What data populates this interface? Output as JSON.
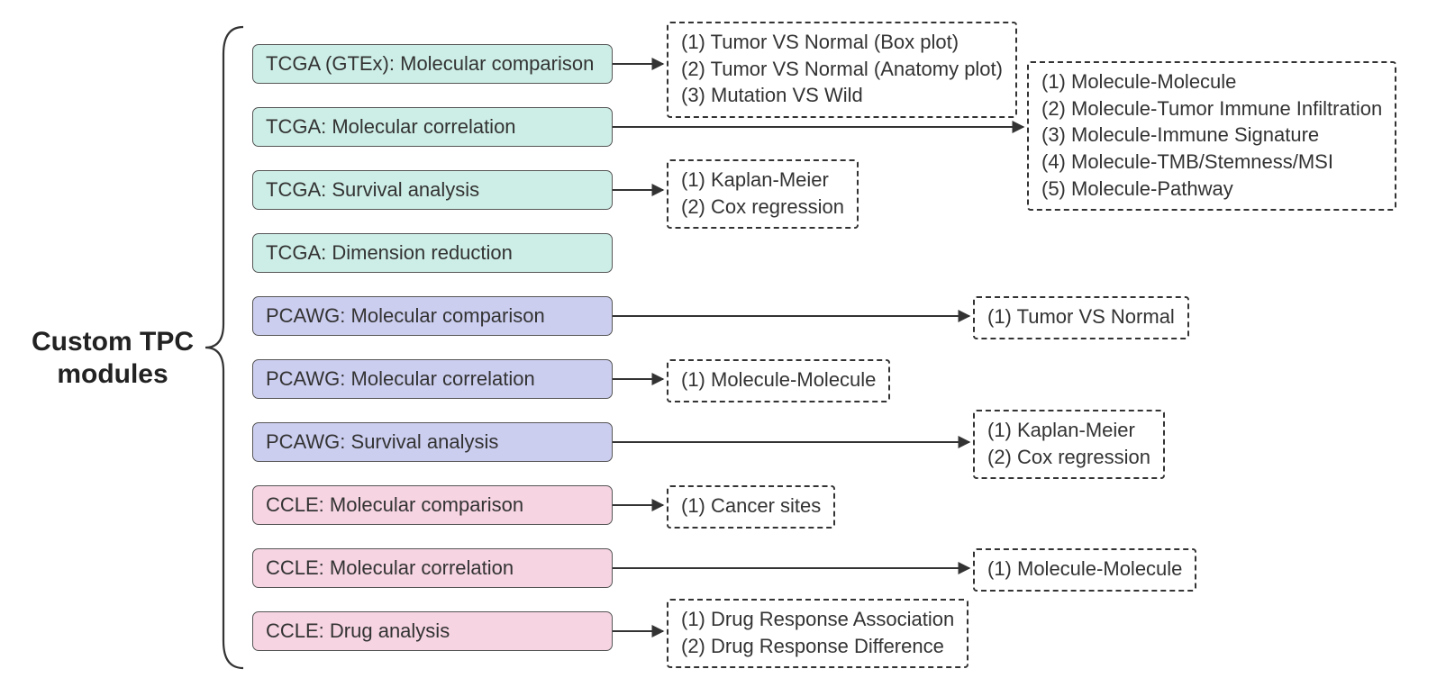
{
  "title": "Custom TPC\nmodules",
  "modules": [
    {
      "label": "TCGA (GTEx): Molecular comparison",
      "class": "green"
    },
    {
      "label": "TCGA: Molecular correlation",
      "class": "green"
    },
    {
      "label": "TCGA: Survival analysis",
      "class": "green"
    },
    {
      "label": "TCGA: Dimension reduction",
      "class": "green"
    },
    {
      "label": "PCAWG: Molecular comparison",
      "class": "purple"
    },
    {
      "label": "PCAWG: Molecular correlation",
      "class": "purple"
    },
    {
      "label": "PCAWG: Survival analysis",
      "class": "purple"
    },
    {
      "label": "CCLE: Molecular comparison",
      "class": "pink"
    },
    {
      "label": "CCLE: Molecular correlation",
      "class": "pink"
    },
    {
      "label": "CCLE: Drug analysis",
      "class": "pink"
    }
  ],
  "details": {
    "tcga_comparison": [
      "(1) Tumor VS Normal (Box plot)",
      "(2) Tumor VS Normal (Anatomy plot)",
      "(3) Mutation VS Wild"
    ],
    "tcga_correlation": [
      "(1) Molecule-Molecule",
      "(2) Molecule-Tumor Immune Infiltration",
      "(3) Molecule-Immune Signature",
      "(4) Molecule-TMB/Stemness/MSI",
      "(5) Molecule-Pathway"
    ],
    "tcga_survival": [
      "(1) Kaplan-Meier",
      "(2) Cox regression"
    ],
    "pcawg_comparison": [
      "(1) Tumor VS Normal"
    ],
    "pcawg_correlation": [
      "(1) Molecule-Molecule"
    ],
    "pcawg_survival": [
      "(1) Kaplan-Meier",
      "(2) Cox regression"
    ],
    "ccle_comparison": [
      "(1) Cancer sites"
    ],
    "ccle_correlation": [
      "(1) Molecule-Molecule"
    ],
    "ccle_drug": [
      "(1) Drug Response Association",
      "(2) Drug Response Difference"
    ]
  }
}
